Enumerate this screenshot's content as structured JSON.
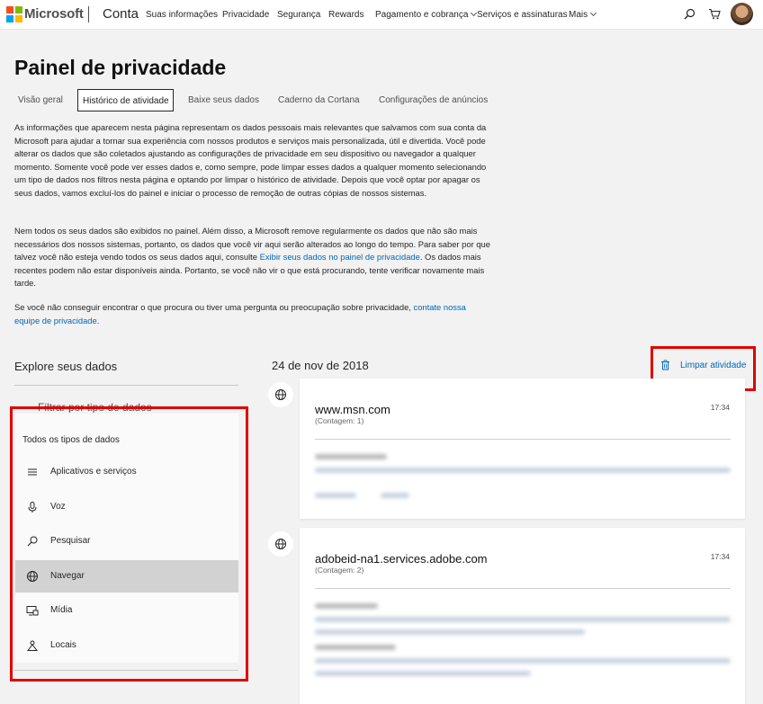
{
  "header": {
    "brand": "Microsoft",
    "section": "Conta",
    "nav": [
      "Suas informações",
      "Privacidade",
      "Segurança",
      "Rewards",
      "Pagamento e cobrança",
      "Serviços e assinaturas",
      "Mais"
    ]
  },
  "page": {
    "title": "Painel de privacidade",
    "tabs": [
      "Visão geral",
      "Histórico de atividade",
      "Baixe seus dados",
      "Caderno da Cortana",
      "Configurações de anúncios"
    ]
  },
  "intro": {
    "p1": "As informações que aparecem nesta página representam os dados pessoais mais relevantes que salvamos com sua conta da Microsoft para ajudar a tornar sua experiência com nossos produtos e serviços mais personalizada, útil e divertida. Você pode alterar os dados que são coletados ajustando as configurações de privacidade em seu dispositivo ou navegador a qualquer momento. Somente você pode ver esses dados e, como sempre, pode limpar esses dados a qualquer momento selecionando um tipo de dados nos filtros nesta página e optando por limpar o histórico de atividade. Depois que você optar por apagar os seus dados, vamos excluí-los do painel e iniciar o processo de remoção de outras cópias de nossos sistemas.",
    "p2_a": "Nem todos os seus dados são exibidos no painel. Além disso, a Microsoft remove regularmente os dados que não são mais necessários dos nossos sistemas, portanto, os dados que você vir aqui serão alterados ao longo do tempo. Para saber por que talvez você não esteja vendo todos os seus dados aqui, consulte",
    "p2_link": "Exibir seus dados no painel de privacidade",
    "p2_b": ". Os dados mais recentes podem não estar disponíveis ainda. Portanto, se você não vir o que está procurando, tente verificar novamente mais tarde.",
    "p3_a": "Se você não conseguir encontrar o que procura ou tiver uma pergunta ou preocupação sobre privacidade,",
    "p3_link": "contate nossa equipe de privacidade",
    "p3_b": "."
  },
  "explore": {
    "heading": "Explore seus dados",
    "filter_label": "Filtrar por tipo de dados",
    "all_types": "Todos os tipos de dados",
    "items": [
      {
        "label": "Aplicativos e serviços",
        "icon": "list-icon"
      },
      {
        "label": "Voz",
        "icon": "microphone-icon"
      },
      {
        "label": "Pesquisar",
        "icon": "search-icon"
      },
      {
        "label": "Navegar",
        "icon": "globe-icon"
      },
      {
        "label": "Mídia",
        "icon": "media-icon"
      },
      {
        "label": "Locais",
        "icon": "location-icon"
      }
    ],
    "selected": "Navegar"
  },
  "activity": {
    "date": "24 de nov de 2018",
    "clear_label": "Limpar atividade",
    "cards": [
      {
        "domain": "www.msn.com",
        "count": "(Contagem: 1)",
        "time": "17:34"
      },
      {
        "domain": "adobeid-na1.services.adobe.com",
        "count": "(Contagem: 2)",
        "time": "17:34"
      }
    ]
  },
  "colors": {
    "accent": "#0067b8",
    "highlight": "#e00000",
    "selected_bg": "#d2d2d2"
  }
}
